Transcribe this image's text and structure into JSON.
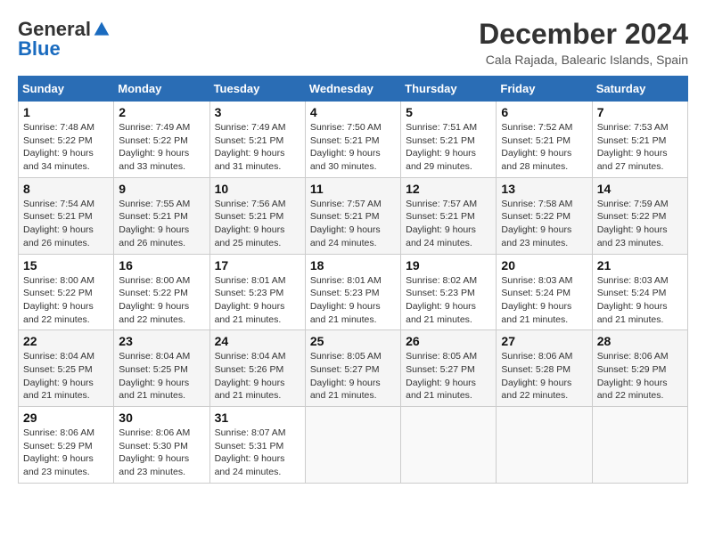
{
  "header": {
    "logo_general": "General",
    "logo_blue": "Blue",
    "month_title": "December 2024",
    "location": "Cala Rajada, Balearic Islands, Spain"
  },
  "weekdays": [
    "Sunday",
    "Monday",
    "Tuesday",
    "Wednesday",
    "Thursday",
    "Friday",
    "Saturday"
  ],
  "weeks": [
    [
      {
        "day": "1",
        "sunrise": "7:48 AM",
        "sunset": "5:22 PM",
        "daylight": "9 hours and 34 minutes"
      },
      {
        "day": "2",
        "sunrise": "7:49 AM",
        "sunset": "5:22 PM",
        "daylight": "9 hours and 33 minutes"
      },
      {
        "day": "3",
        "sunrise": "7:49 AM",
        "sunset": "5:21 PM",
        "daylight": "9 hours and 31 minutes"
      },
      {
        "day": "4",
        "sunrise": "7:50 AM",
        "sunset": "5:21 PM",
        "daylight": "9 hours and 30 minutes"
      },
      {
        "day": "5",
        "sunrise": "7:51 AM",
        "sunset": "5:21 PM",
        "daylight": "9 hours and 29 minutes"
      },
      {
        "day": "6",
        "sunrise": "7:52 AM",
        "sunset": "5:21 PM",
        "daylight": "9 hours and 28 minutes"
      },
      {
        "day": "7",
        "sunrise": "7:53 AM",
        "sunset": "5:21 PM",
        "daylight": "9 hours and 27 minutes"
      }
    ],
    [
      {
        "day": "8",
        "sunrise": "7:54 AM",
        "sunset": "5:21 PM",
        "daylight": "9 hours and 26 minutes"
      },
      {
        "day": "9",
        "sunrise": "7:55 AM",
        "sunset": "5:21 PM",
        "daylight": "9 hours and 26 minutes"
      },
      {
        "day": "10",
        "sunrise": "7:56 AM",
        "sunset": "5:21 PM",
        "daylight": "9 hours and 25 minutes"
      },
      {
        "day": "11",
        "sunrise": "7:57 AM",
        "sunset": "5:21 PM",
        "daylight": "9 hours and 24 minutes"
      },
      {
        "day": "12",
        "sunrise": "7:57 AM",
        "sunset": "5:21 PM",
        "daylight": "9 hours and 24 minutes"
      },
      {
        "day": "13",
        "sunrise": "7:58 AM",
        "sunset": "5:22 PM",
        "daylight": "9 hours and 23 minutes"
      },
      {
        "day": "14",
        "sunrise": "7:59 AM",
        "sunset": "5:22 PM",
        "daylight": "9 hours and 23 minutes"
      }
    ],
    [
      {
        "day": "15",
        "sunrise": "8:00 AM",
        "sunset": "5:22 PM",
        "daylight": "9 hours and 22 minutes"
      },
      {
        "day": "16",
        "sunrise": "8:00 AM",
        "sunset": "5:22 PM",
        "daylight": "9 hours and 22 minutes"
      },
      {
        "day": "17",
        "sunrise": "8:01 AM",
        "sunset": "5:23 PM",
        "daylight": "9 hours and 21 minutes"
      },
      {
        "day": "18",
        "sunrise": "8:01 AM",
        "sunset": "5:23 PM",
        "daylight": "9 hours and 21 minutes"
      },
      {
        "day": "19",
        "sunrise": "8:02 AM",
        "sunset": "5:23 PM",
        "daylight": "9 hours and 21 minutes"
      },
      {
        "day": "20",
        "sunrise": "8:03 AM",
        "sunset": "5:24 PM",
        "daylight": "9 hours and 21 minutes"
      },
      {
        "day": "21",
        "sunrise": "8:03 AM",
        "sunset": "5:24 PM",
        "daylight": "9 hours and 21 minutes"
      }
    ],
    [
      {
        "day": "22",
        "sunrise": "8:04 AM",
        "sunset": "5:25 PM",
        "daylight": "9 hours and 21 minutes"
      },
      {
        "day": "23",
        "sunrise": "8:04 AM",
        "sunset": "5:25 PM",
        "daylight": "9 hours and 21 minutes"
      },
      {
        "day": "24",
        "sunrise": "8:04 AM",
        "sunset": "5:26 PM",
        "daylight": "9 hours and 21 minutes"
      },
      {
        "day": "25",
        "sunrise": "8:05 AM",
        "sunset": "5:27 PM",
        "daylight": "9 hours and 21 minutes"
      },
      {
        "day": "26",
        "sunrise": "8:05 AM",
        "sunset": "5:27 PM",
        "daylight": "9 hours and 21 minutes"
      },
      {
        "day": "27",
        "sunrise": "8:06 AM",
        "sunset": "5:28 PM",
        "daylight": "9 hours and 22 minutes"
      },
      {
        "day": "28",
        "sunrise": "8:06 AM",
        "sunset": "5:29 PM",
        "daylight": "9 hours and 22 minutes"
      }
    ],
    [
      {
        "day": "29",
        "sunrise": "8:06 AM",
        "sunset": "5:29 PM",
        "daylight": "9 hours and 23 minutes"
      },
      {
        "day": "30",
        "sunrise": "8:06 AM",
        "sunset": "5:30 PM",
        "daylight": "9 hours and 23 minutes"
      },
      {
        "day": "31",
        "sunrise": "8:07 AM",
        "sunset": "5:31 PM",
        "daylight": "9 hours and 24 minutes"
      },
      null,
      null,
      null,
      null
    ]
  ]
}
